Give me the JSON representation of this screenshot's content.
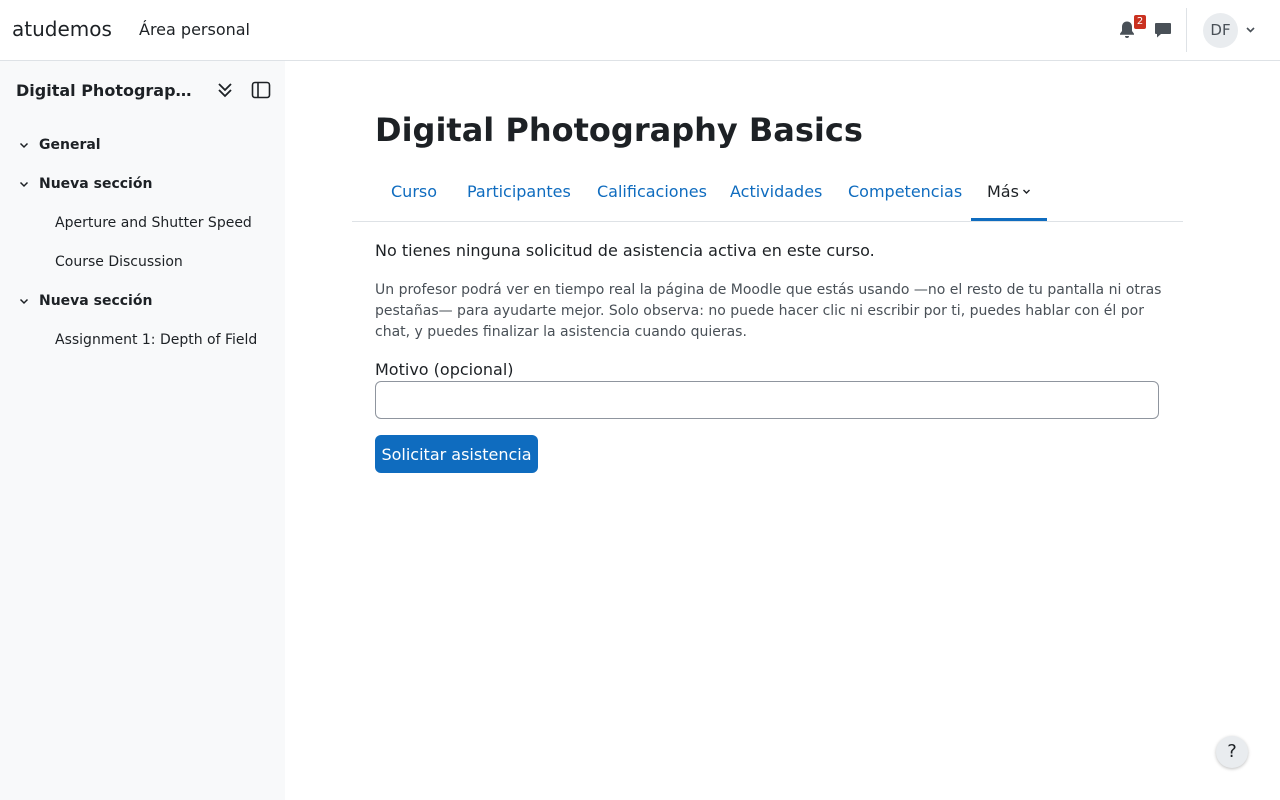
{
  "navbar": {
    "brand": "atudemos",
    "home_link": "Área personal",
    "notification_count": "2",
    "avatar_initials": "DF"
  },
  "drawer": {
    "course_title": "Digital Photography Basics",
    "sections": [
      {
        "label": "General",
        "activities": []
      },
      {
        "label": "Nueva sección",
        "activities": [
          "Aperture and Shutter Speed",
          "Course Discussion"
        ]
      },
      {
        "label": "Nueva sección",
        "activities": [
          "Assignment 1: Depth of Field"
        ]
      }
    ]
  },
  "main": {
    "title": "Digital Photography Basics",
    "tabs": [
      "Curso",
      "Participantes",
      "Calificaciones",
      "Actividades",
      "Competencias",
      "Más"
    ],
    "active_tab": "Más",
    "heading": "No tienes ninguna solicitud de asistencia activa en este curso.",
    "description": "Un profesor podrá ver en tiempo real la página de Moodle que estás usando —no el resto de tu pantalla ni otras pestañas— para ayudarte mejor. Solo observa: no puede hacer clic ni escribir por ti, puedes hablar con él por chat, y puedes finalizar la asistencia cuando quieras.",
    "reason_label": "Motivo (opcional)",
    "reason_value": "",
    "submit_label": "Solicitar asistencia"
  },
  "help_button": "?",
  "colors": {
    "primary": "#0f6cbf",
    "badge": "#ca3120",
    "drawer_bg": "#f8f9fa"
  }
}
